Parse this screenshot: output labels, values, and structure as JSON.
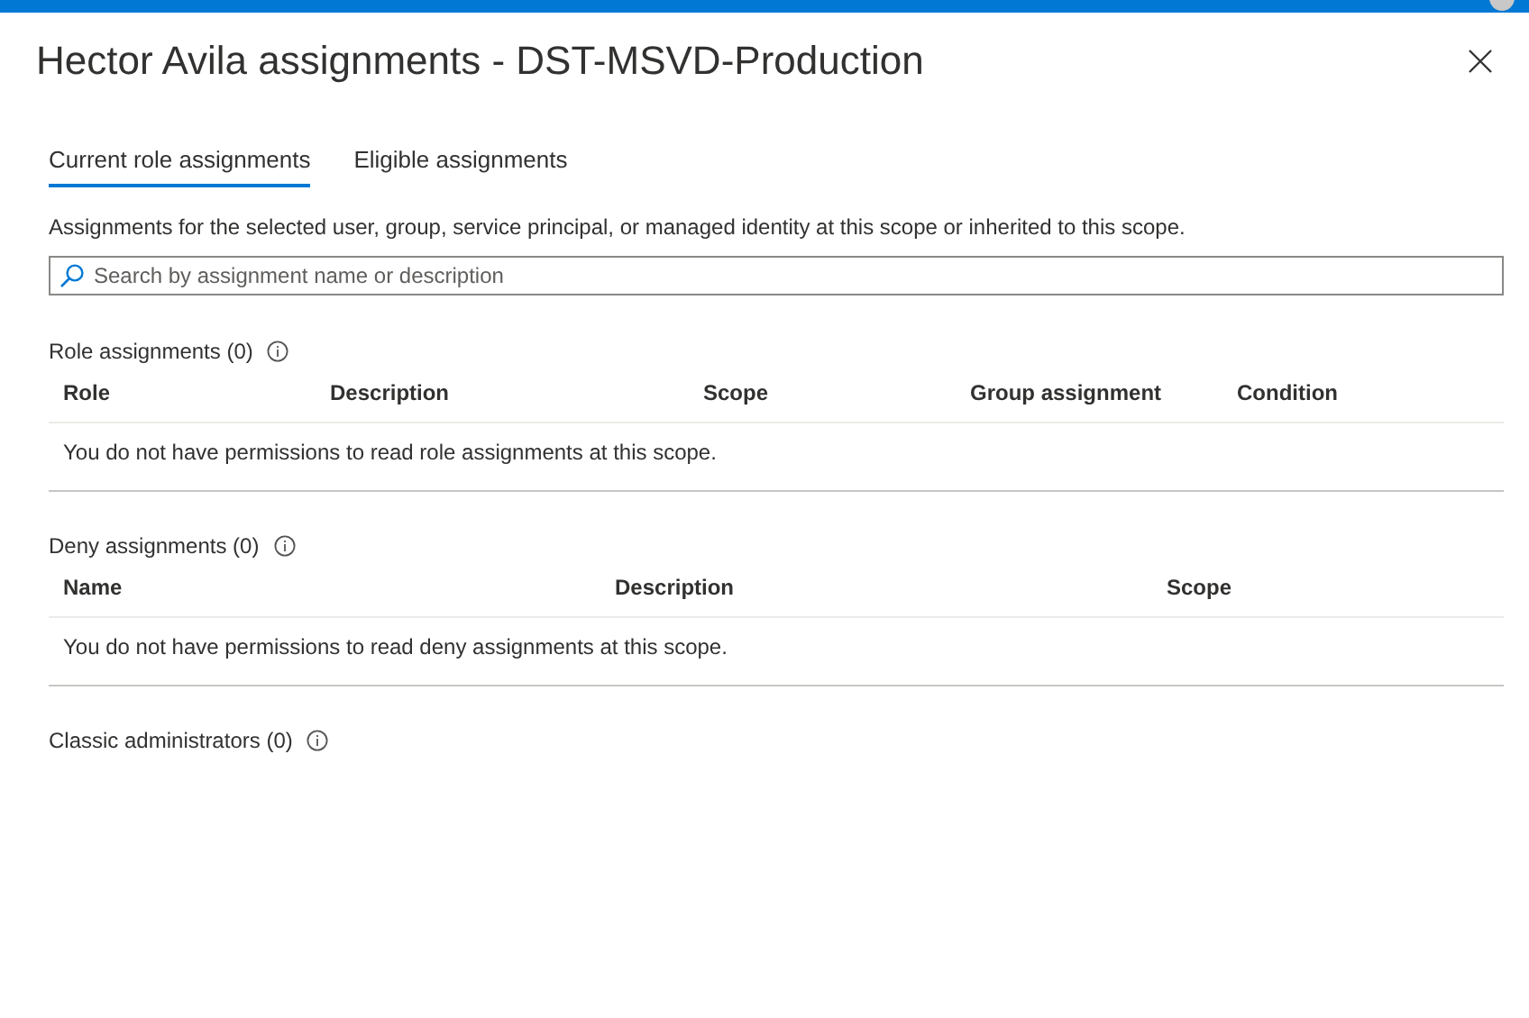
{
  "window": {
    "title": "Hector Avila assignments - DST-MSVD-Production"
  },
  "tabs": [
    {
      "label": "Current role assignments",
      "selected": true
    },
    {
      "label": "Eligible assignments",
      "selected": false
    }
  ],
  "description": "Assignments for the selected user, group, service principal, or managed identity at this scope or inherited to this scope.",
  "search": {
    "placeholder": "Search by assignment name or description"
  },
  "sections": [
    {
      "title": "Role assignments (0)",
      "columns": [
        "Role",
        "Description",
        "Scope",
        "Group assignment",
        "Condition"
      ],
      "message": "You do not have permissions to read role assignments at this scope."
    },
    {
      "title": "Deny assignments (0)",
      "columns": [
        "Name",
        "Description",
        "Scope"
      ],
      "message": "You do not have permissions to read deny assignments at this scope."
    },
    {
      "title": "Classic administrators (0)"
    }
  ]
}
